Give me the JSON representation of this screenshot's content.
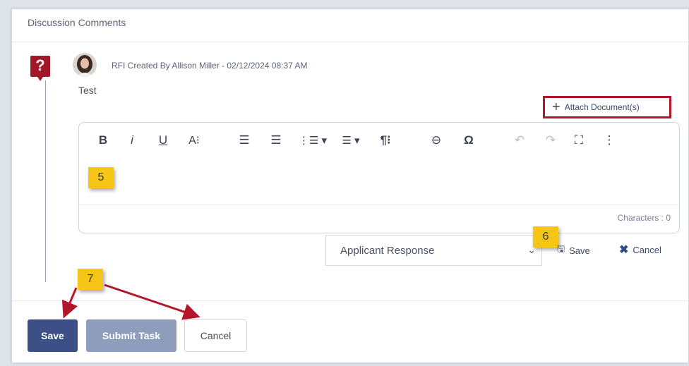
{
  "section": {
    "title": "Discussion Comments"
  },
  "comment": {
    "meta": "RFI Created By Allison Miller - 02/12/2024 08:37 AM",
    "text": "Test"
  },
  "attach": {
    "label": "Attach Document(s)"
  },
  "editor": {
    "toolbar": [
      {
        "name": "bold-button",
        "glyph": "B"
      },
      {
        "name": "italic-button",
        "glyph": "i"
      },
      {
        "name": "underline-button",
        "glyph": "U"
      },
      {
        "name": "font-size-button",
        "glyph": "A⁝"
      },
      {
        "name": "align-left-button",
        "glyph": "☰"
      },
      {
        "name": "align-center-button",
        "glyph": "☰"
      },
      {
        "name": "ordered-list-button",
        "glyph": "⋮☰ ▾"
      },
      {
        "name": "unordered-list-button",
        "glyph": "☰ ▾"
      },
      {
        "name": "paragraph-format-button",
        "glyph": "¶⁝"
      },
      {
        "name": "insert-link-button",
        "glyph": "⊖"
      },
      {
        "name": "special-chars-button",
        "glyph": "Ω"
      },
      {
        "name": "undo-button",
        "glyph": "↶"
      },
      {
        "name": "redo-button",
        "glyph": "↷"
      },
      {
        "name": "fullscreen-button",
        "glyph": "⛶"
      },
      {
        "name": "more-button",
        "glyph": "⋮"
      }
    ],
    "char_count": "Characters : 0"
  },
  "response": {
    "selected": "Applicant Response",
    "save_label": "Save",
    "cancel_label": "Cancel"
  },
  "callouts": {
    "five": "5",
    "six": "6",
    "seven": "7"
  },
  "actions": {
    "save": "Save",
    "submit": "Submit Task",
    "cancel": "Cancel"
  },
  "colors": {
    "primary": "#3c4f86",
    "primary_disabled": "#8f9dbd",
    "highlight": "#f7c516",
    "annotation_red": "#b3162b"
  }
}
